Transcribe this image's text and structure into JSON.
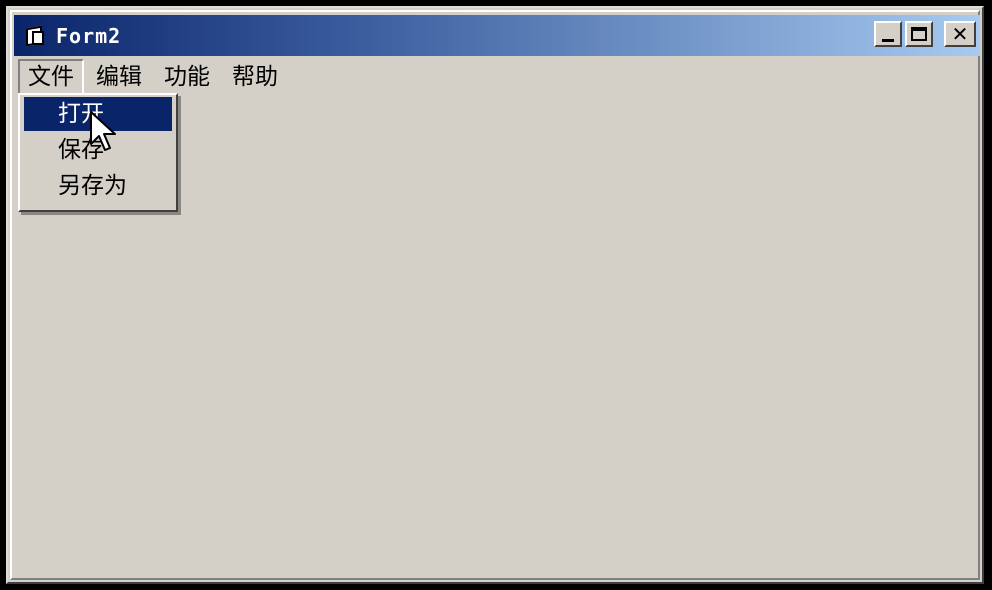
{
  "window": {
    "title": "Form2"
  },
  "menu": [
    {
      "label": "文件"
    },
    {
      "label": "编辑"
    },
    {
      "label": "功能"
    },
    {
      "label": "帮助"
    }
  ],
  "dropdown": [
    {
      "label": "打开"
    },
    {
      "label": "保存"
    },
    {
      "label": "另存为"
    }
  ],
  "colors": {
    "titlebar_start": "#0a246a",
    "titlebar_end": "#a6caf0",
    "highlight": "#0a246a",
    "face": "#d4d0c8"
  },
  "icons": [
    "form-app-icon",
    "minimize-icon",
    "maximize-icon",
    "close-icon",
    "mouse-cursor-icon"
  ]
}
